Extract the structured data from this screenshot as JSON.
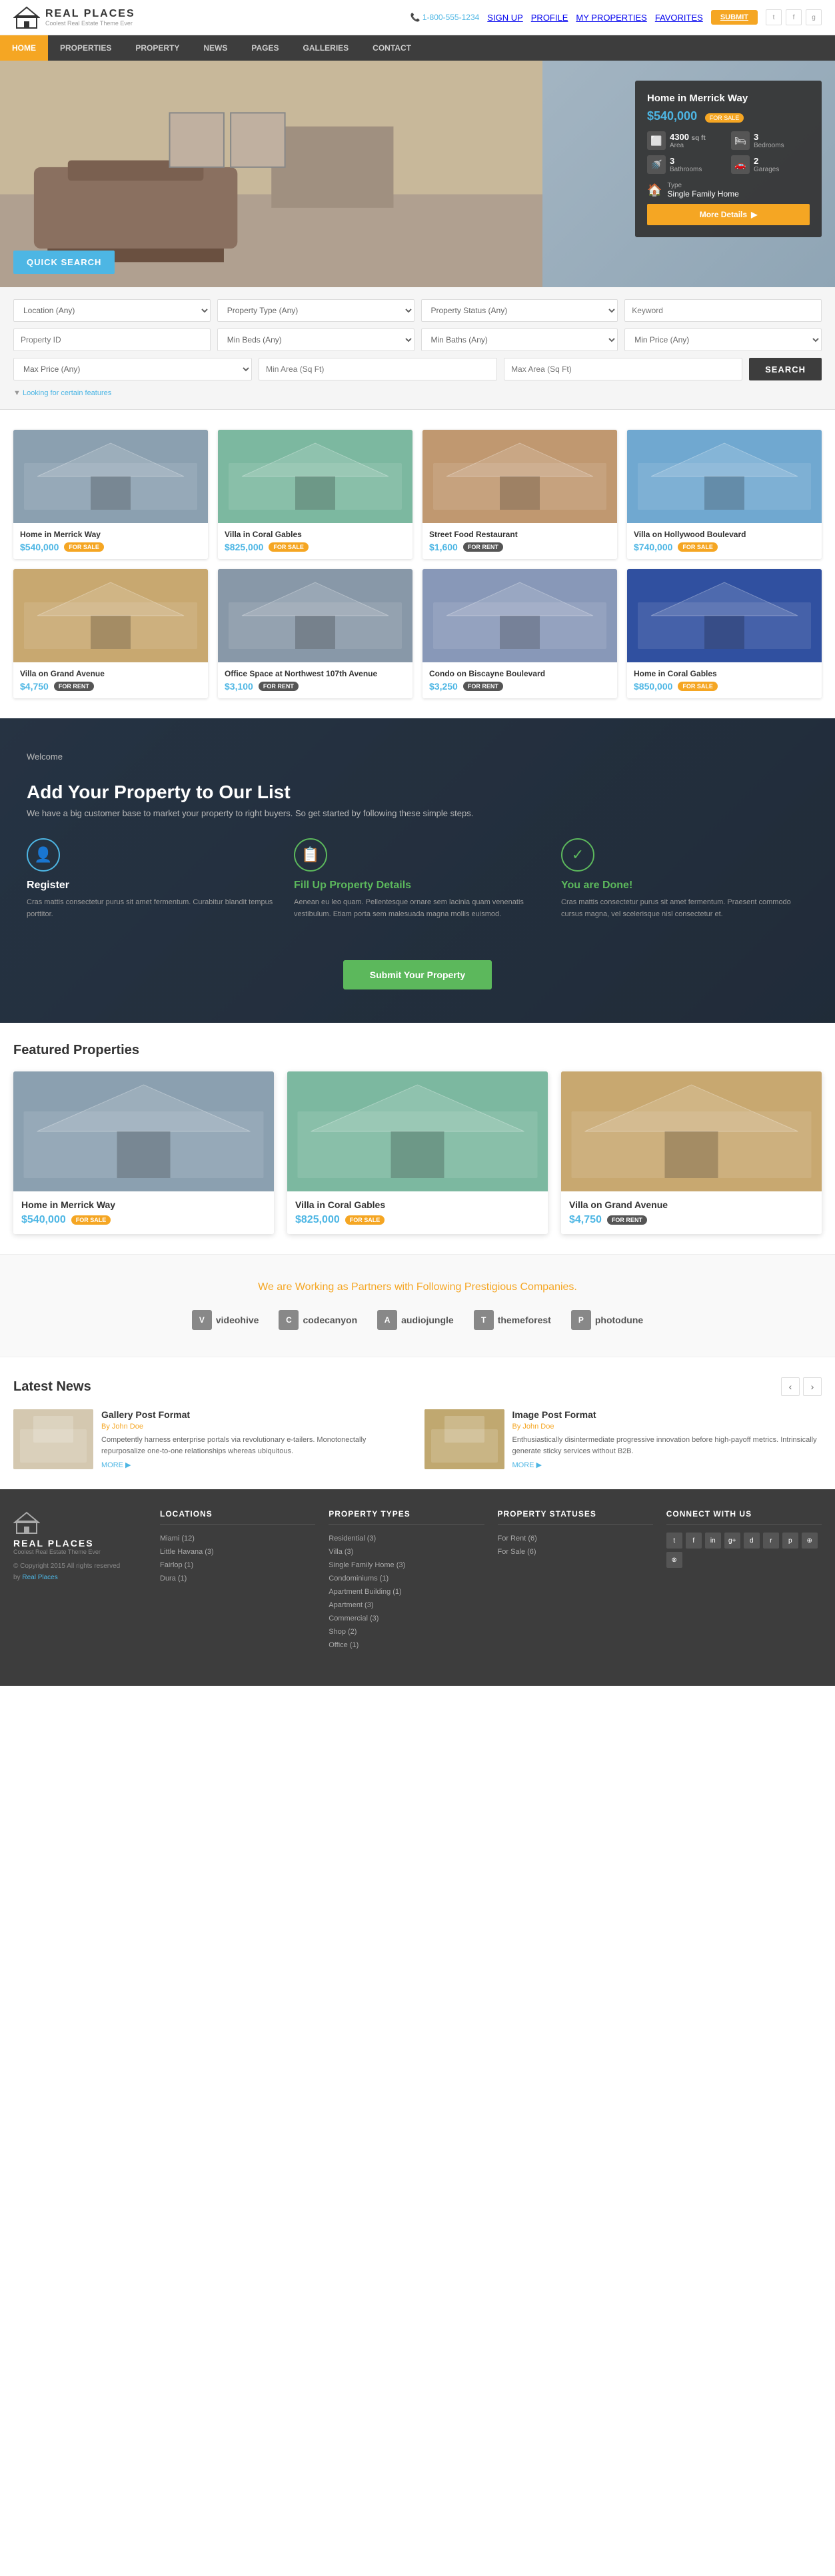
{
  "topbar": {
    "phone": "1-800-555-1234",
    "sign_up": "SIGN UP",
    "profile": "PROFILE",
    "my_properties": "MY PROPERTIES",
    "favorites": "FAVORITES",
    "submit": "SUBMIT",
    "twitter": "t",
    "facebook": "f",
    "google": "g+"
  },
  "nav": {
    "items": [
      {
        "label": "HOME",
        "active": true
      },
      {
        "label": "PROPERTIES",
        "active": false
      },
      {
        "label": "PROPERTY",
        "active": false
      },
      {
        "label": "NEWS",
        "active": false
      },
      {
        "label": "PAGES",
        "active": false
      },
      {
        "label": "GALLERIES",
        "active": false
      },
      {
        "label": "CONTACT",
        "active": false
      }
    ]
  },
  "hero": {
    "title": "Home in Merrick Way",
    "price": "$540,000",
    "badge": "FOR SALE",
    "area_val": "4300",
    "area_unit": "sq ft",
    "area_label": "Area",
    "bedrooms_val": "3",
    "bedrooms_label": "Bedrooms",
    "bathrooms_val": "3",
    "bathrooms_label": "Bathrooms",
    "garages_val": "2",
    "garages_label": "Garages",
    "type_label": "Type",
    "type_val": "Single Family Home",
    "btn_more": "More Details"
  },
  "quick_search": {
    "label": "QUICK SEARCH",
    "location": "Location (Any)",
    "property_type": "Property Type (Any)",
    "property_status": "Property Status (Any)",
    "keyword": "Keyword",
    "property_id": "Property ID",
    "min_beds": "Min Beds (Any)",
    "min_baths": "Min Baths (Any)",
    "min_price": "Min Price (Any)",
    "max_price": "Max Price (Any)",
    "min_area": "Min Area (Sq Ft)",
    "max_area": "Max Area (Sq Ft)",
    "search_btn": "SEARCH",
    "features_link": "Looking for certain features"
  },
  "properties": [
    {
      "title": "Home in Merrick Way",
      "price": "$540,000",
      "status": "FOR SALE",
      "status_type": "sale",
      "img_class": "img-house1"
    },
    {
      "title": "Villa in Coral Gables",
      "price": "$825,000",
      "status": "FOR SALE",
      "status_type": "sale",
      "img_class": "img-house2"
    },
    {
      "title": "Street Food Restaurant",
      "price": "$1,600",
      "status": "FOR RENT",
      "status_type": "rent",
      "img_class": "img-house3"
    },
    {
      "title": "Villa on Hollywood Boulevard",
      "price": "$740,000",
      "status": "FOR SALE",
      "status_type": "sale",
      "img_class": "img-house4"
    },
    {
      "title": "Villa on Grand Avenue",
      "price": "$4,750",
      "status": "FOR RENT",
      "status_type": "rent",
      "img_class": "img-house5"
    },
    {
      "title": "Office Space at Northwest 107th Avenue",
      "price": "$3,100",
      "status": "FOR RENT",
      "status_type": "rent",
      "img_class": "img-house6"
    },
    {
      "title": "Condo on Biscayne Boulevard",
      "price": "$3,250",
      "status": "FOR RENT",
      "status_type": "rent",
      "img_class": "img-house7"
    },
    {
      "title": "Home in Coral Gables",
      "price": "$850,000",
      "status": "FOR SALE",
      "status_type": "sale",
      "img_class": "img-house8"
    }
  ],
  "add_property": {
    "welcome": "Welcome",
    "title": "Add Your Property to Our List",
    "subtitle": "We have a big customer base to market your property to right buyers. So get started by following these simple steps.",
    "step1_title": "Register",
    "step1_text": "Cras mattis consectetur purus sit amet fermentum. Curabitur blandit tempus porttitor.",
    "step2_title": "Fill Up Property Details",
    "step2_text": "Aenean eu leo quam. Pellentesque ornare sem lacinia quam venenatis vestibulum. Etiam porta sem malesuada magna mollis euismod.",
    "step3_title": "You are Done!",
    "step3_text": "Cras mattis consectetur purus sit amet fermentum. Praesent commodo cursus magna, vel scelerisque nisl consectetur et.",
    "btn": "Submit Your Property"
  },
  "featured": {
    "title": "Featured Properties",
    "items": [
      {
        "title": "Home in Merrick Way",
        "price": "$540,000",
        "status": "FOR SALE",
        "status_type": "sale",
        "img_class": "img-house1"
      },
      {
        "title": "Villa in Coral Gables",
        "price": "$825,000",
        "status": "FOR SALE",
        "status_type": "sale",
        "img_class": "img-house2"
      },
      {
        "title": "Villa on Grand Avenue",
        "price": "$4,750",
        "status": "FOR RENT",
        "status_type": "rent",
        "img_class": "img-house5"
      }
    ]
  },
  "partners": {
    "title": "We are Working as",
    "highlight": "Partners",
    "suffix": "with Following Prestigious Companies.",
    "logos": [
      {
        "name": "videohive",
        "icon": "V"
      },
      {
        "name": "codecanyon",
        "icon": "C"
      },
      {
        "name": "audiojungle",
        "icon": "A"
      },
      {
        "name": "themeforest",
        "icon": "T"
      },
      {
        "name": "photodune",
        "icon": "P"
      }
    ]
  },
  "news": {
    "title": "Latest News",
    "items": [
      {
        "title": "Gallery Post Format",
        "author": "John Doe",
        "text": "Competently harness enterprise portals via revolutionary e-tailers. Monotonectally repurposalize one-to-one relationships whereas ubiquitous.",
        "more": "MORE",
        "img_class": "img-news1"
      },
      {
        "title": "Image Post Format",
        "author": "John Doe",
        "text": "Enthusiastically disintermediate progressive innovation before high-payoff metrics. Intrinsically generate sticky services without B2B.",
        "more": "MORE",
        "img_class": "img-news2"
      }
    ]
  },
  "footer": {
    "brand": "REAL PLACES",
    "tagline": "Coolest Real Estate Theme Ever",
    "copyright": "© Copyright 2015 All rights reserved",
    "by": "by",
    "by_link": "Real Places",
    "columns": [
      {
        "heading": "LOCATIONS",
        "items": [
          {
            "label": "Miami (12)"
          },
          {
            "label": "Little Havana (3)"
          },
          {
            "label": "Fairlop (1)"
          },
          {
            "label": "Dura (1)"
          }
        ]
      },
      {
        "heading": "PROPERTY TYPES",
        "items": [
          {
            "label": "Residential (3)"
          },
          {
            "label": "Villa (3)"
          },
          {
            "label": "Single Family Home (3)"
          },
          {
            "label": "Condominiums (1)"
          },
          {
            "label": "Apartment Building (1)"
          },
          {
            "label": "Apartment (3)"
          },
          {
            "label": "Commercial (3)"
          },
          {
            "label": "Shop (2)"
          },
          {
            "label": "Office (1)"
          }
        ]
      },
      {
        "heading": "PROPERTY STATUSES",
        "items": [
          {
            "label": "For Rent (6)"
          },
          {
            "label": "For Sale (6)"
          }
        ]
      },
      {
        "heading": "CONNECT WITH US",
        "social": [
          "t",
          "f",
          "in",
          "g+",
          "d",
          "r",
          "p",
          "⊕",
          "⊗"
        ]
      }
    ]
  }
}
